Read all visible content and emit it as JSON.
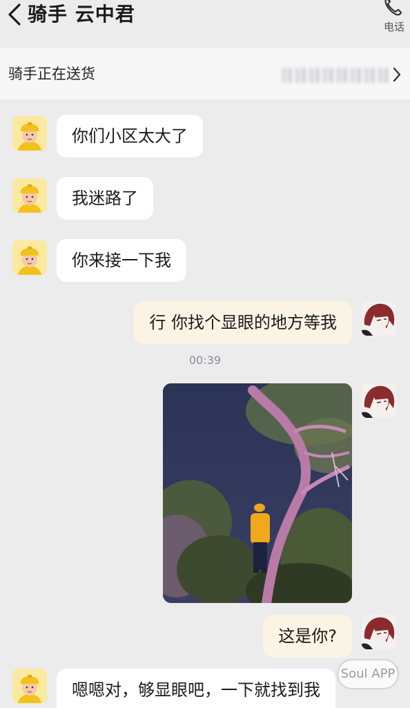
{
  "header": {
    "title": "骑手  云中君",
    "phone_label": "电话"
  },
  "delivery_bar": {
    "status": "骑手正在送货"
  },
  "messages": [
    {
      "sender": "rider",
      "text": "你们小区太大了"
    },
    {
      "sender": "rider",
      "text": "我迷路了"
    },
    {
      "sender": "rider",
      "text": "你来接一下我"
    },
    {
      "sender": "me",
      "text": "行 你找个显眼的地方等我"
    },
    {
      "sender": "me",
      "type": "image"
    },
    {
      "sender": "me",
      "text": "这是你?"
    },
    {
      "sender": "rider",
      "text": "嗯嗯对，够显眼吧，一下就找到我"
    }
  ],
  "timestamp": "00:39",
  "watermark": "Soul APP",
  "colors": {
    "background": "#ececed",
    "incoming_bubble": "#ffffff",
    "outgoing_bubble": "#fbf4e4",
    "rider_helmet": "#f2c21c"
  },
  "icons": {
    "back": "chevron-left-icon",
    "phone": "phone-icon",
    "delivery_arrow": "chevron-right-icon"
  }
}
